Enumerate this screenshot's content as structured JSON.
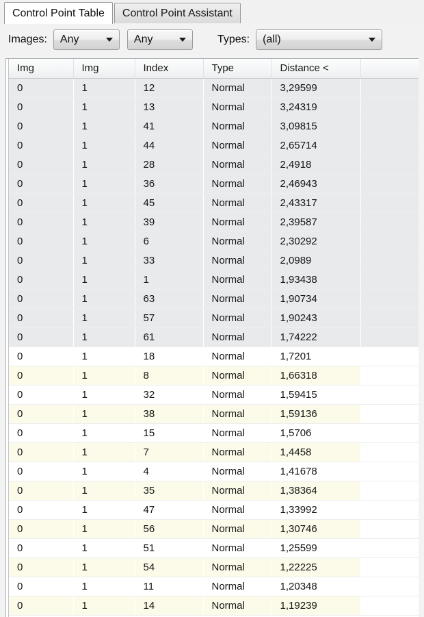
{
  "tabs": [
    {
      "label": "Control Point Table",
      "active": true
    },
    {
      "label": "Control Point Assistant",
      "active": false
    }
  ],
  "toolbar": {
    "images_label": "Images:",
    "images_filter_a": "Any",
    "images_filter_b": "Any",
    "types_label": "Types:",
    "types_filter": "(all)",
    "caret_icon": "chevron-down-icon"
  },
  "table": {
    "columns": [
      "Img",
      "Img",
      "Index",
      "Type",
      "Distance <"
    ],
    "sort_column": "Distance <",
    "sort_indicator": "<",
    "colors": {
      "selection": "#e9eaec",
      "alt_row": "#fcfbe9",
      "plain_row": "#ffffff",
      "header": "#f1f3f4",
      "grid_line": "#eceef0",
      "frame": "#a9b0b6"
    },
    "selected_row_count": 14,
    "rows": [
      {
        "img1": "0",
        "img2": "1",
        "index": "12",
        "type": "Normal",
        "distance": "3,29599",
        "style": "sel"
      },
      {
        "img1": "0",
        "img2": "1",
        "index": "13",
        "type": "Normal",
        "distance": "3,24319",
        "style": "sel"
      },
      {
        "img1": "0",
        "img2": "1",
        "index": "41",
        "type": "Normal",
        "distance": "3,09815",
        "style": "sel"
      },
      {
        "img1": "0",
        "img2": "1",
        "index": "44",
        "type": "Normal",
        "distance": "2,65714",
        "style": "sel"
      },
      {
        "img1": "0",
        "img2": "1",
        "index": "28",
        "type": "Normal",
        "distance": "2,4918",
        "style": "sel"
      },
      {
        "img1": "0",
        "img2": "1",
        "index": "36",
        "type": "Normal",
        "distance": "2,46943",
        "style": "sel"
      },
      {
        "img1": "0",
        "img2": "1",
        "index": "45",
        "type": "Normal",
        "distance": "2,43317",
        "style": "sel"
      },
      {
        "img1": "0",
        "img2": "1",
        "index": "39",
        "type": "Normal",
        "distance": "2,39587",
        "style": "sel"
      },
      {
        "img1": "0",
        "img2": "1",
        "index": "6",
        "type": "Normal",
        "distance": "2,30292",
        "style": "sel"
      },
      {
        "img1": "0",
        "img2": "1",
        "index": "33",
        "type": "Normal",
        "distance": "2,0989",
        "style": "sel"
      },
      {
        "img1": "0",
        "img2": "1",
        "index": "1",
        "type": "Normal",
        "distance": "1,93438",
        "style": "sel"
      },
      {
        "img1": "0",
        "img2": "1",
        "index": "63",
        "type": "Normal",
        "distance": "1,90734",
        "style": "sel"
      },
      {
        "img1": "0",
        "img2": "1",
        "index": "57",
        "type": "Normal",
        "distance": "1,90243",
        "style": "sel"
      },
      {
        "img1": "0",
        "img2": "1",
        "index": "61",
        "type": "Normal",
        "distance": "1,74222",
        "style": "sel"
      },
      {
        "img1": "0",
        "img2": "1",
        "index": "18",
        "type": "Normal",
        "distance": "1,7201",
        "style": "plain"
      },
      {
        "img1": "0",
        "img2": "1",
        "index": "8",
        "type": "Normal",
        "distance": "1,66318",
        "style": "alt"
      },
      {
        "img1": "0",
        "img2": "1",
        "index": "32",
        "type": "Normal",
        "distance": "1,59415",
        "style": "plain"
      },
      {
        "img1": "0",
        "img2": "1",
        "index": "38",
        "type": "Normal",
        "distance": "1,59136",
        "style": "alt"
      },
      {
        "img1": "0",
        "img2": "1",
        "index": "15",
        "type": "Normal",
        "distance": "1,5706",
        "style": "plain"
      },
      {
        "img1": "0",
        "img2": "1",
        "index": "7",
        "type": "Normal",
        "distance": "1,4458",
        "style": "alt"
      },
      {
        "img1": "0",
        "img2": "1",
        "index": "4",
        "type": "Normal",
        "distance": "1,41678",
        "style": "plain"
      },
      {
        "img1": "0",
        "img2": "1",
        "index": "35",
        "type": "Normal",
        "distance": "1,38364",
        "style": "alt"
      },
      {
        "img1": "0",
        "img2": "1",
        "index": "47",
        "type": "Normal",
        "distance": "1,33992",
        "style": "plain"
      },
      {
        "img1": "0",
        "img2": "1",
        "index": "56",
        "type": "Normal",
        "distance": "1,30746",
        "style": "alt"
      },
      {
        "img1": "0",
        "img2": "1",
        "index": "51",
        "type": "Normal",
        "distance": "1,25599",
        "style": "plain"
      },
      {
        "img1": "0",
        "img2": "1",
        "index": "54",
        "type": "Normal",
        "distance": "1,22225",
        "style": "alt"
      },
      {
        "img1": "0",
        "img2": "1",
        "index": "11",
        "type": "Normal",
        "distance": "1,20348",
        "style": "plain"
      },
      {
        "img1": "0",
        "img2": "1",
        "index": "14",
        "type": "Normal",
        "distance": "1,19239",
        "style": "alt"
      }
    ]
  }
}
